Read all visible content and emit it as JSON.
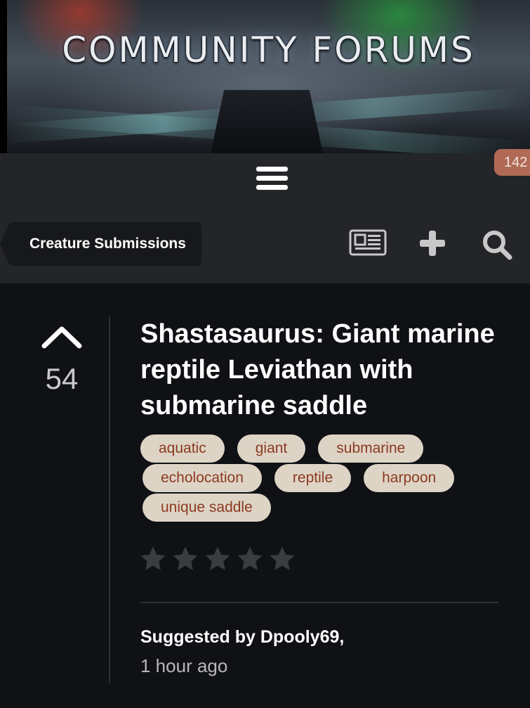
{
  "banner": {
    "title": "COMMUNITY FORUMS"
  },
  "header": {
    "notification_count": "142",
    "breadcrumb": "Creature Submissions",
    "icons": [
      "hamburger-menu-icon",
      "newspaper-icon",
      "plus-icon",
      "search-icon"
    ]
  },
  "post": {
    "votes": "54",
    "title": "Shastasaurus: Giant marine reptile Leviathan with submarine saddle",
    "tags": [
      "aquatic",
      "giant",
      "submarine",
      "echolocation",
      "reptile",
      "harpoon",
      "unique saddle"
    ],
    "rating": {
      "filled": 0,
      "max": 5
    },
    "suggested_by": "Suggested by Dpooly69,",
    "time_ago": "1 hour ago"
  },
  "colors": {
    "background": "#0f1115",
    "navbar": "#232528",
    "breadcrumb_bg": "#17181b",
    "badge": "#b06a55",
    "tag_bg": "#ded4c6",
    "tag_text": "#8b3a20",
    "star_empty": "#3a3c40"
  }
}
